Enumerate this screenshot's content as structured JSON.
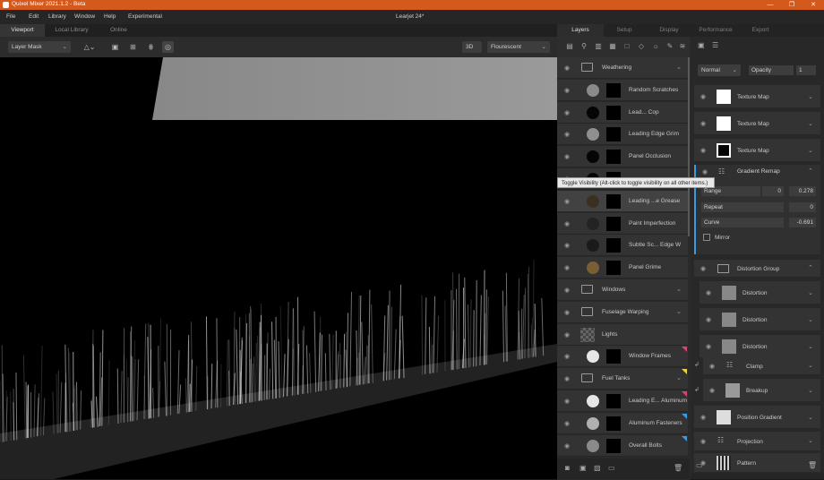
{
  "app": {
    "title": "Quixel Mixer 2021.1.2 - Beta",
    "document": "Learjet 24*"
  },
  "menu": [
    "File",
    "Edit",
    "Library",
    "Window",
    "Help",
    "Experimental"
  ],
  "viewport_tabs": [
    "Viewport",
    "Local Library",
    "Online"
  ],
  "toolbar": {
    "mask_dropdown": "Layer Mask",
    "view_mode": "3D",
    "lighting": "Flourescent"
  },
  "right_tabs": [
    "Layers",
    "Setup",
    "Display",
    "Performance",
    "Export"
  ],
  "layers": [
    {
      "name": "Weathering",
      "type": "folder"
    },
    {
      "name": "Random Scratches",
      "circle": "#8a8a8a"
    },
    {
      "name": "Lead... Cop",
      "circle": "#050505"
    },
    {
      "name": "Leading Edge Grim",
      "circle": "#8f8f8f"
    },
    {
      "name": "Panel Occlusion",
      "circle": "#050505"
    },
    {
      "name": "",
      "circle": "#050505"
    },
    {
      "name": "Leading ...e Grease",
      "circle": "#3b2f22"
    },
    {
      "name": "Paint Imperfection",
      "circle": "#232323"
    },
    {
      "name": "Subtle Sc... Edge W",
      "circle": "#1a1a1a"
    },
    {
      "name": "Panel Grime",
      "circle": "#7a5f35"
    },
    {
      "name": "Windows",
      "type": "folder"
    },
    {
      "name": "Fuselage Warping",
      "type": "folder"
    },
    {
      "name": "Lights",
      "type": "checker"
    },
    {
      "name": "Window Frames",
      "circle": "#e6e6e6",
      "tag": "#e0407a"
    },
    {
      "name": "Fuel Tanks",
      "type": "folder",
      "tag": "#e8d040"
    },
    {
      "name": "Leading E... Aluminum",
      "circle": "#e6e6e6",
      "tag": "#e0407a"
    },
    {
      "name": "Aluminum Fasteners",
      "circle": "#b0b0b0",
      "tag": "#3a9ae0"
    },
    {
      "name": "Overall Bolts",
      "circle": "#8a8a8a",
      "tag": "#3a9ae0"
    }
  ],
  "tooltip": "Toggle Visibility (Alt-click to toggle visibility on all other items.)",
  "props": {
    "blend_mode": "Normal",
    "opacity_label": "Opacity",
    "opacity_value": "1",
    "texture_maps": [
      "Texture Map",
      "Texture Map",
      "Texture Map"
    ],
    "gradient_remap": {
      "title": "Gradient Remap",
      "range_label": "Range",
      "range_min": "0",
      "range_max": "0.278",
      "repeat_label": "Repeat",
      "repeat_value": "0",
      "curve_label": "Curve",
      "curve_value": "-0.691",
      "mirror_label": "Mirror"
    },
    "distortion_group": {
      "title": "Distortion Group",
      "items": [
        "Distortion",
        "Distortion",
        "Distortion"
      ]
    },
    "modifiers": [
      "Clamp",
      "Breakup",
      "Position Gradient",
      "Projection",
      "Pattern"
    ]
  },
  "colors": {
    "accent": "#d4591d",
    "selection": "#3a9ae0"
  }
}
